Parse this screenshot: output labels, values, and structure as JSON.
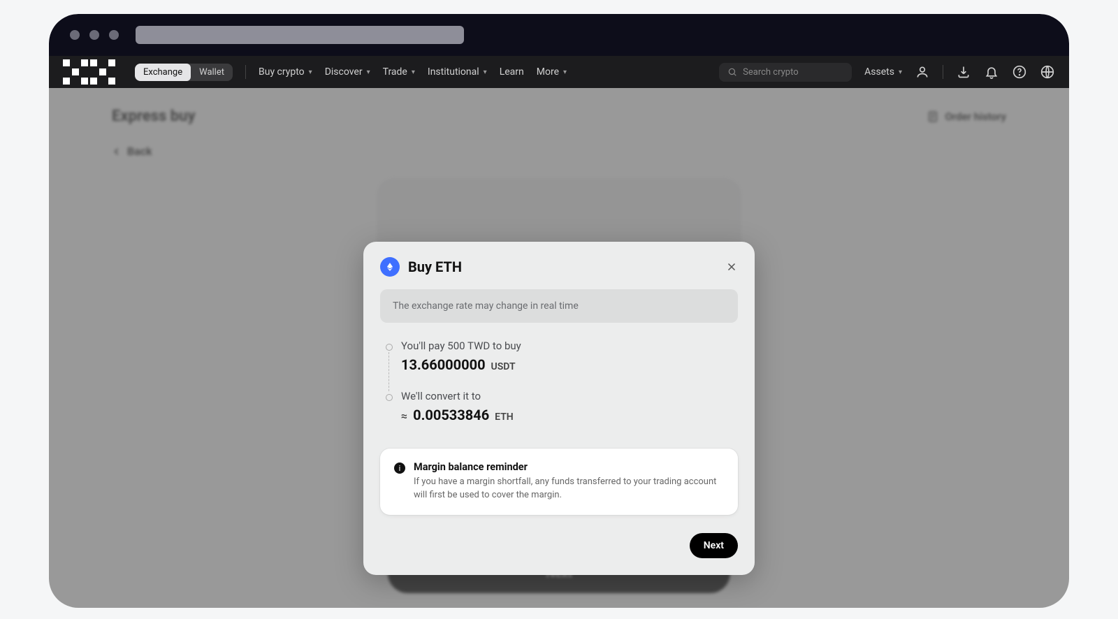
{
  "nav": {
    "tabs": {
      "exchange": "Exchange",
      "wallet": "Wallet"
    },
    "items": [
      "Buy crypto",
      "Discover",
      "Trade",
      "Institutional",
      "Learn",
      "More"
    ],
    "search_placeholder": "Search crypto",
    "assets": "Assets"
  },
  "page": {
    "title": "Express buy",
    "order_history": "Order history",
    "back": "Back",
    "bg_next": "Next"
  },
  "modal": {
    "title": "Buy ETH",
    "rate_note": "The exchange rate may change in real time",
    "pay_label": "You'll pay 500 TWD to buy",
    "pay_amount": "13.66000000",
    "pay_unit": "USDT",
    "convert_label": "We'll convert it to",
    "convert_approx": "≈",
    "convert_amount": "0.00533846",
    "convert_unit": "ETH",
    "info_title": "Margin balance reminder",
    "info_body": "If you have a margin shortfall, any funds transferred to your trading account will first be used to cover the margin.",
    "next": "Next"
  }
}
